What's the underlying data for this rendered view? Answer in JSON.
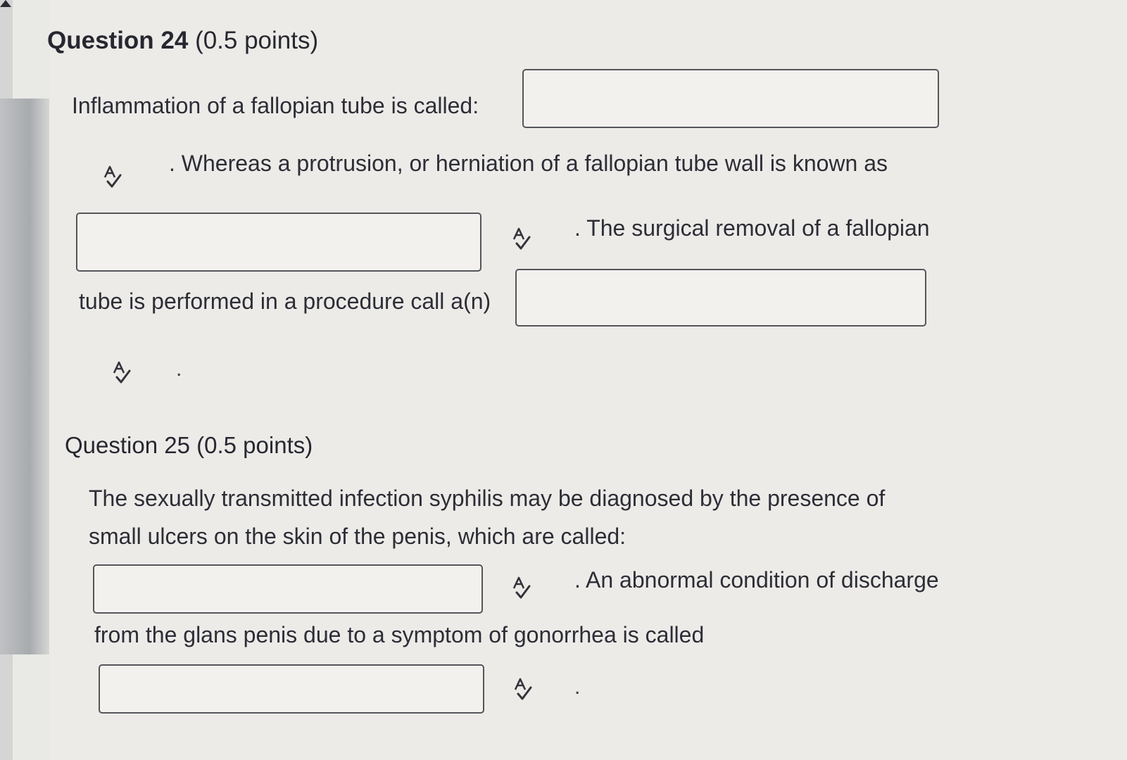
{
  "q24": {
    "number_label": "Question 24",
    "points_label": "(0.5 points)",
    "line1": "Inflammation of a fallopian tube  is called:",
    "line2": ". Whereas a protrusion, or herniation of a fallopian tube wall is known as",
    "line3": ". The surgical removal of a fallopian",
    "line4": "tube is performed in a procedure call a(n)",
    "end_dot": ".",
    "answers": [
      "",
      "",
      ""
    ]
  },
  "q25": {
    "number_label": "Question 25",
    "points_label": "(0.5 points)",
    "line1": "The sexually transmitted infection syphilis may be diagnosed by the presence of",
    "line2": "small ulcers on the skin of the penis, which are called:",
    "line3": ". An abnormal condition of discharge",
    "line4": "from the glans penis due to a symptom of gonorrhea is called",
    "end_dot": ".",
    "answers": [
      "",
      ""
    ]
  },
  "icons": {
    "spellcheck": "spellcheck-icon"
  }
}
